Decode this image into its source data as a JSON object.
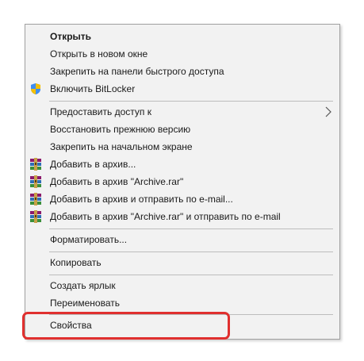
{
  "context_menu": {
    "items": [
      {
        "label": "Открыть",
        "icon": null
      },
      {
        "label": "Открыть в новом окне",
        "icon": null
      },
      {
        "label": "Закрепить на панели быстрого доступа",
        "icon": null
      },
      {
        "label": "Включить BitLocker",
        "icon": "shield-icon"
      },
      {
        "label": "Предоставить доступ к",
        "icon": null,
        "submenu": true
      },
      {
        "label": "Восстановить прежнюю версию",
        "icon": null
      },
      {
        "label": "Закрепить на начальном экране",
        "icon": null
      },
      {
        "label": "Добавить в архив...",
        "icon": "winrar-icon"
      },
      {
        "label": "Добавить в архив \"Archive.rar\"",
        "icon": "winrar-icon"
      },
      {
        "label": "Добавить в архив и отправить по e-mail...",
        "icon": "winrar-icon"
      },
      {
        "label": "Добавить в архив \"Archive.rar\" и отправить по e-mail",
        "icon": "winrar-icon"
      },
      {
        "label": "Форматировать...",
        "icon": null
      },
      {
        "label": "Копировать",
        "icon": null
      },
      {
        "label": "Создать ярлык",
        "icon": null
      },
      {
        "label": "Переименовать",
        "icon": null
      },
      {
        "label": "Свойства",
        "icon": null
      }
    ]
  },
  "highlight_color": "#e0302f",
  "menu_background": "#f2f2f2"
}
